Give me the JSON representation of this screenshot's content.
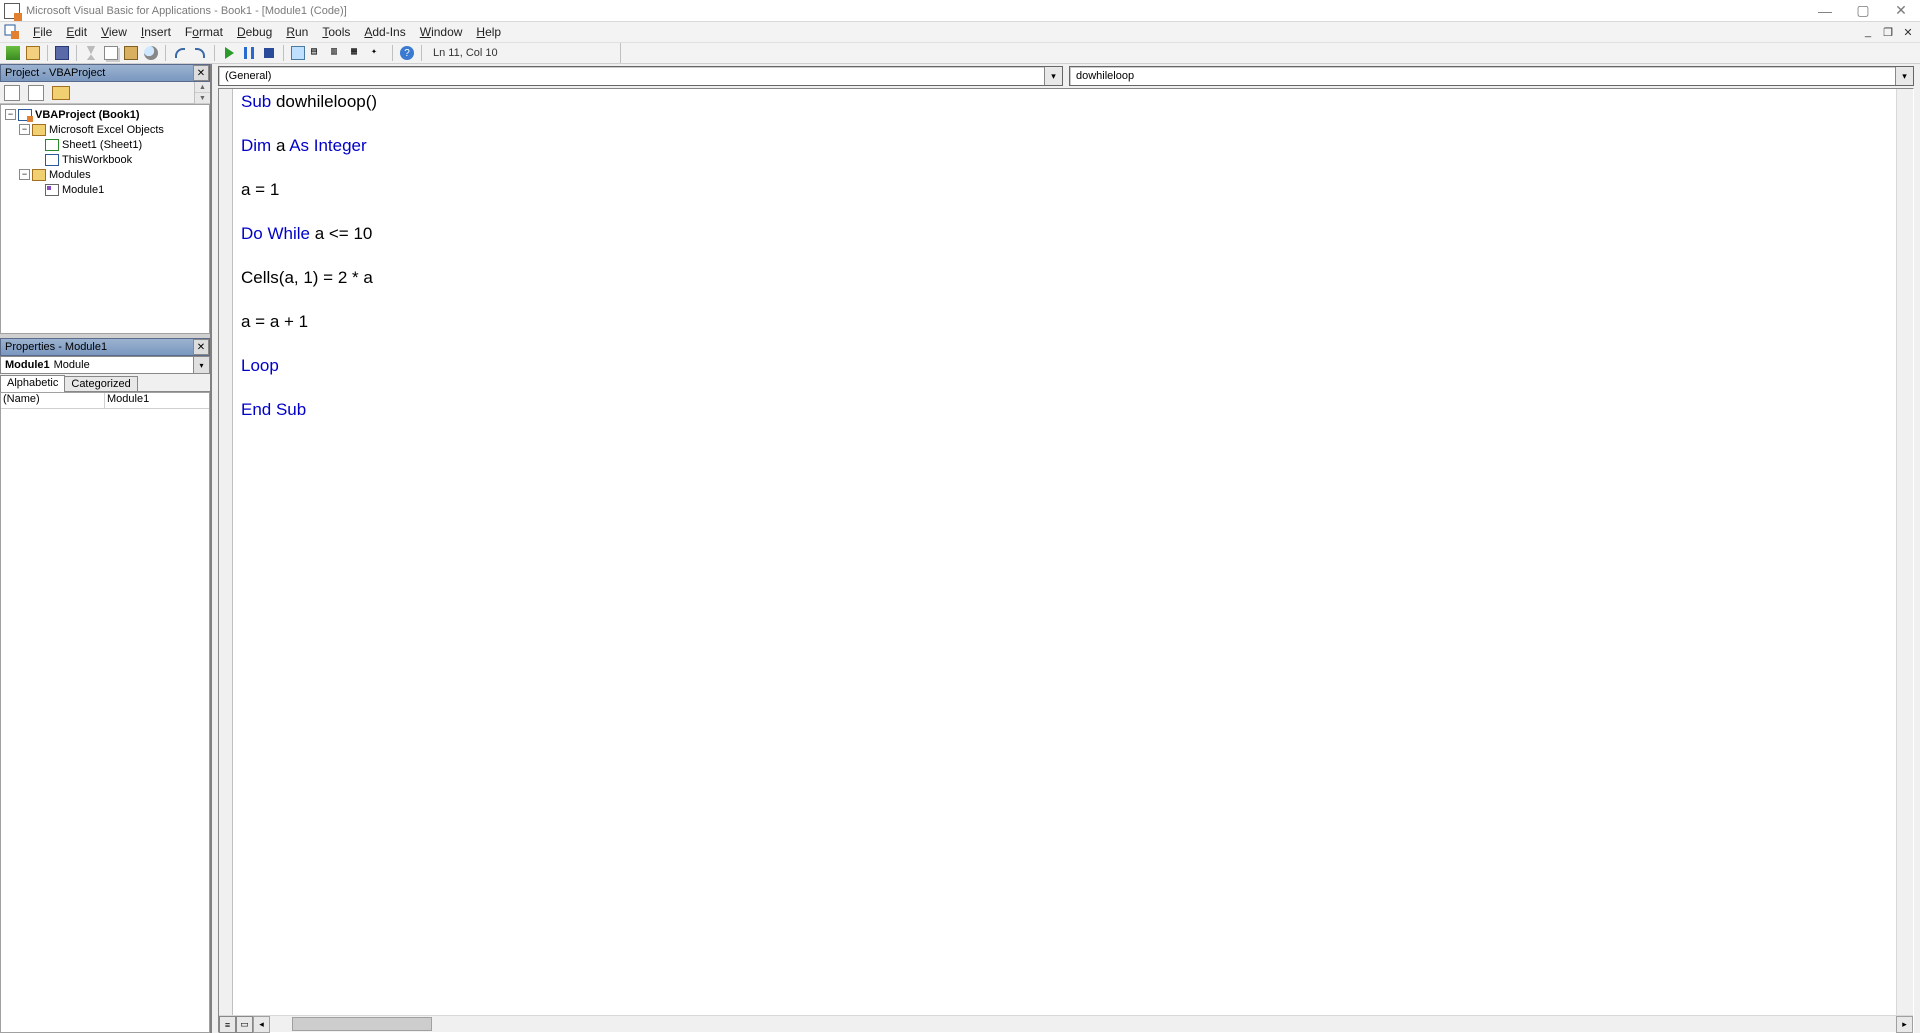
{
  "titlebar": {
    "title": "Microsoft Visual Basic for Applications - Book1 - [Module1 (Code)]"
  },
  "menus": {
    "file": "File",
    "edit": "Edit",
    "view": "View",
    "insert": "Insert",
    "format": "Format",
    "debug": "Debug",
    "run": "Run",
    "tools": "Tools",
    "addins": "Add-Ins",
    "window": "Window",
    "help": "Help"
  },
  "toolbar": {
    "status": "Ln 11, Col 10"
  },
  "projectPanel": {
    "title": "Project - VBAProject",
    "tree": {
      "root": "VBAProject (Book1)",
      "excelObjects": "Microsoft Excel Objects",
      "sheet1": "Sheet1 (Sheet1)",
      "thisWorkbook": "ThisWorkbook",
      "modules": "Modules",
      "module1": "Module1"
    }
  },
  "propertiesPanel": {
    "title": "Properties - Module1",
    "comboBold": "Module1",
    "comboType": "Module",
    "tabAlpha": "Alphabetic",
    "tabCat": "Categorized",
    "nameKey": "(Name)",
    "nameVal": "Module1"
  },
  "editor": {
    "objectCombo": "(General)",
    "procCombo": "dowhileloop",
    "code": {
      "l1a": "Sub",
      "l1b": " dowhileloop()",
      "l2a": "Dim",
      "l2b": " a ",
      "l2c": "As Integer",
      "l3": "a = 1",
      "l4a": "Do While",
      "l4b": " a <= 10",
      "l5": "Cells(a, 1) = 2 * a",
      "l6": "a = a + 1",
      "l7": "Loop",
      "l8": "End Sub"
    }
  }
}
